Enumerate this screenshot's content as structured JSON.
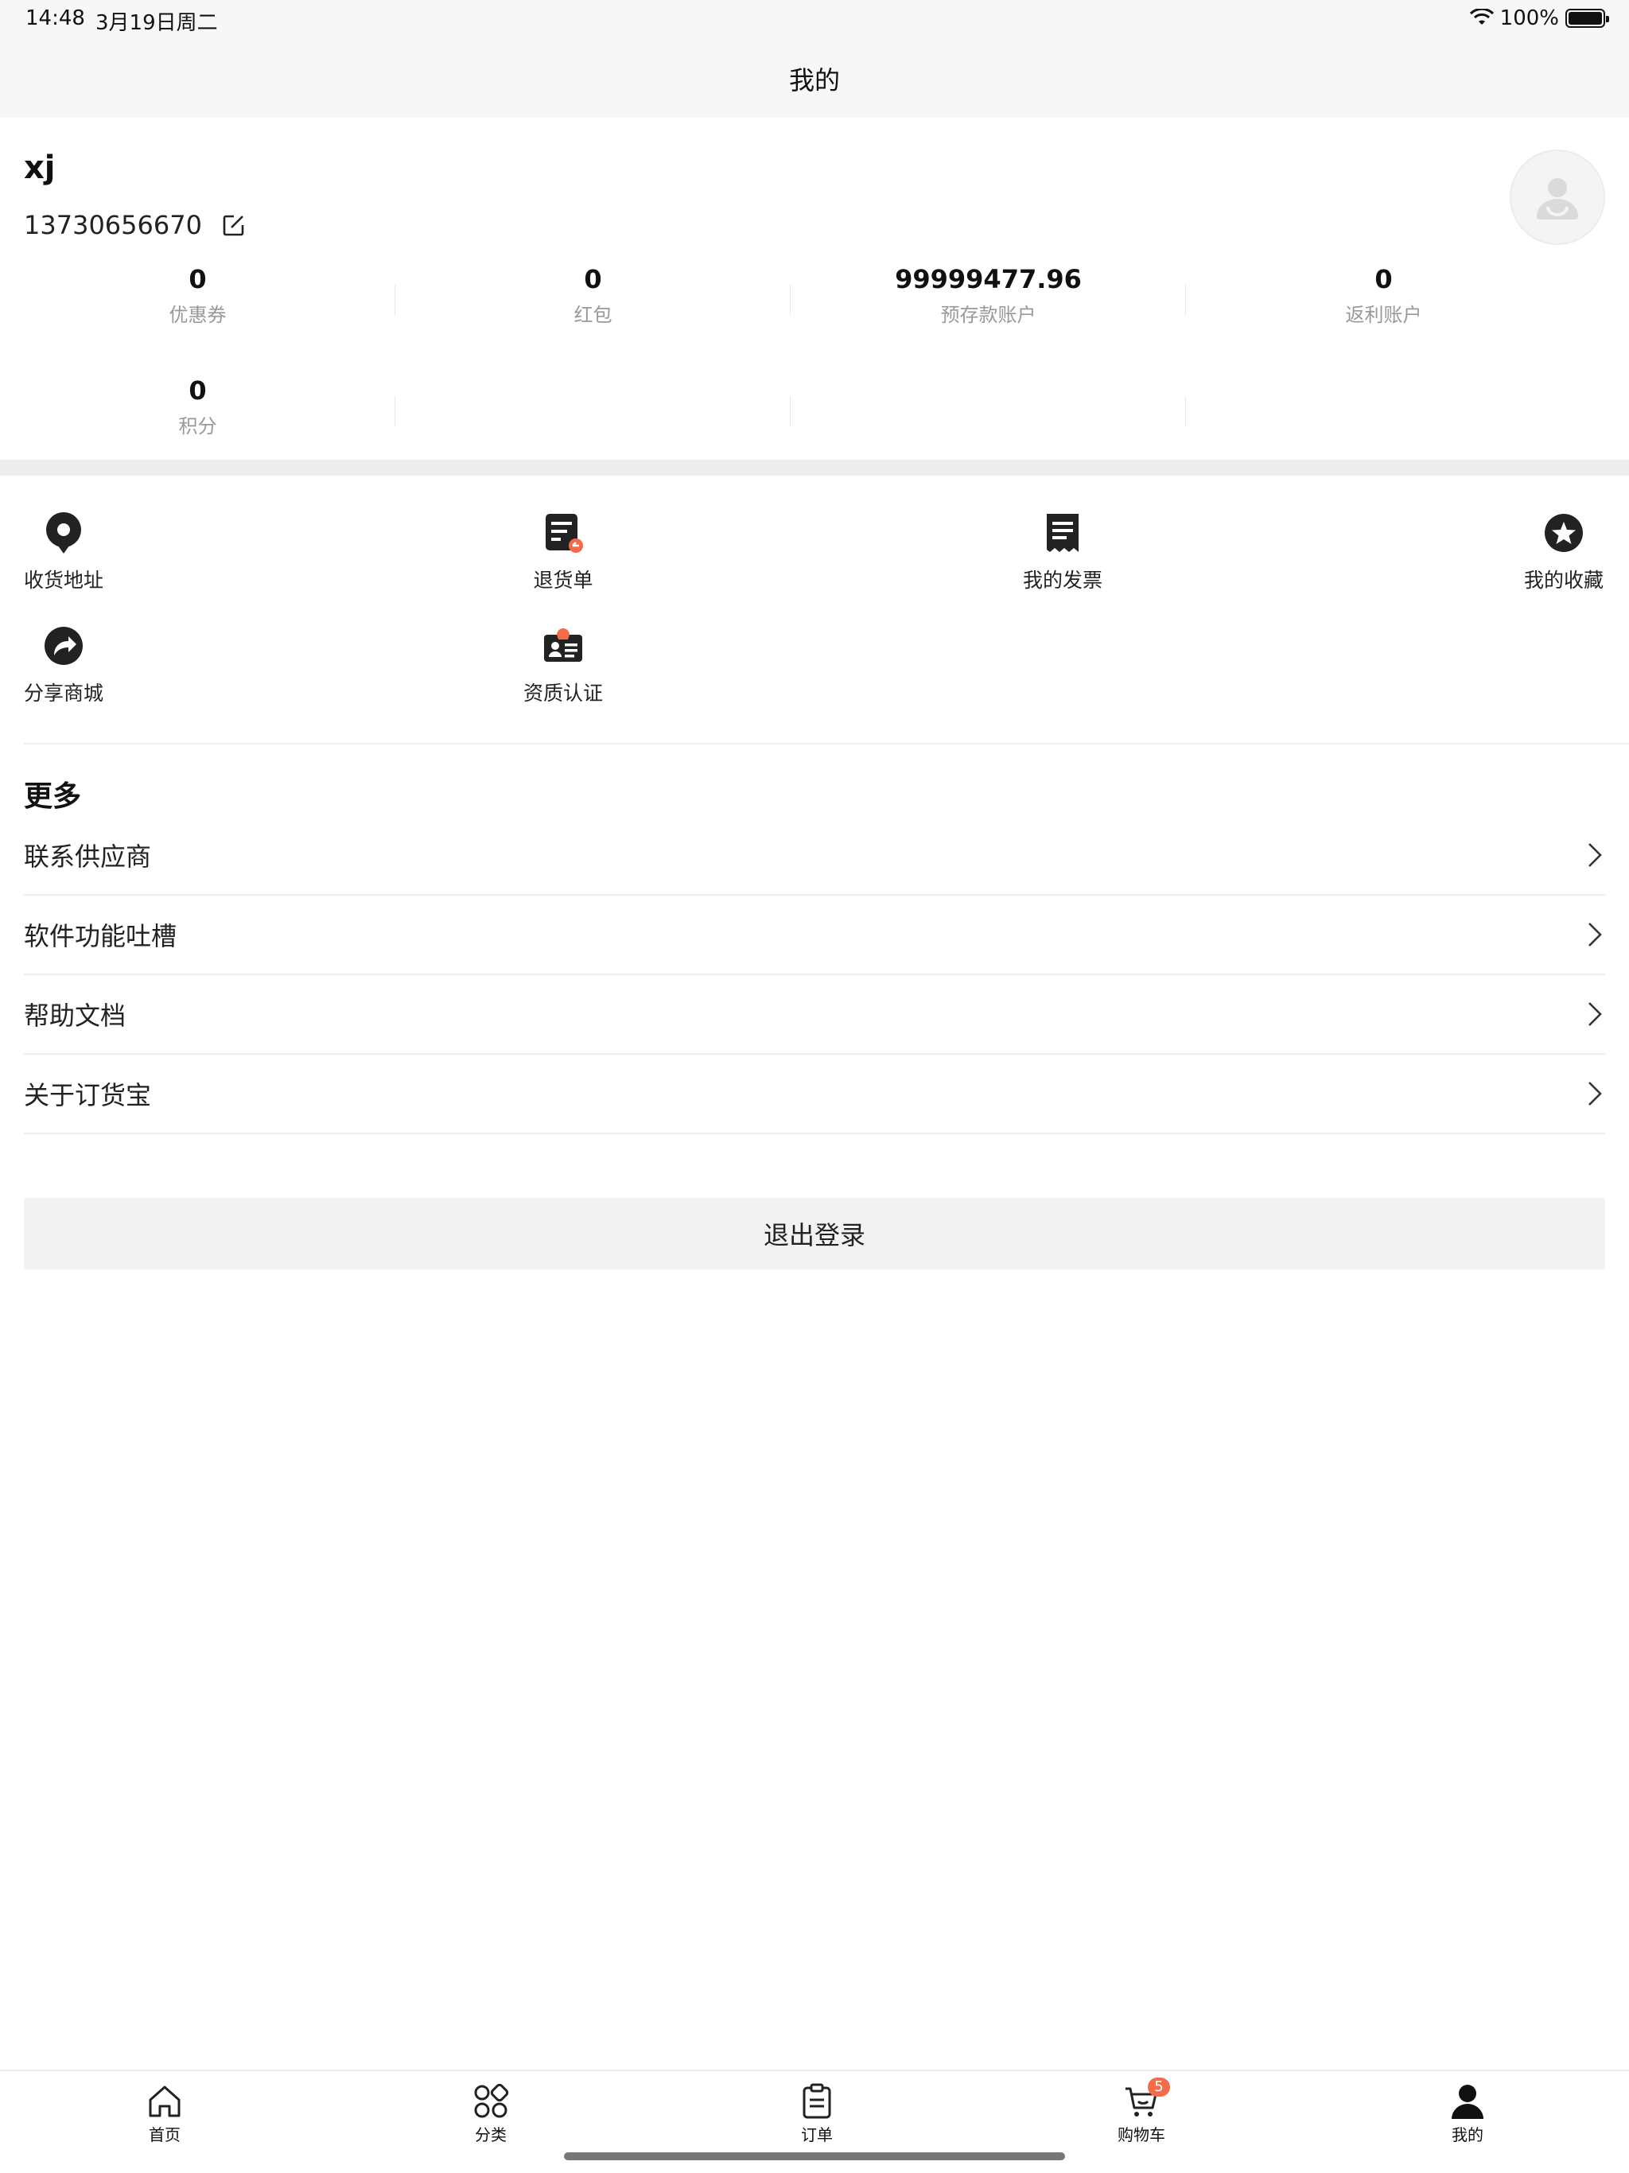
{
  "status_bar": {
    "time": "14:48",
    "date": "3月19日周二",
    "battery": "100%"
  },
  "header": {
    "title": "我的"
  },
  "profile": {
    "name": "xj",
    "phone": "13730656670",
    "stats": [
      {
        "value": "0",
        "label": "优惠券"
      },
      {
        "value": "0",
        "label": "红包"
      },
      {
        "value": "99999477.96",
        "label": "预存款账户"
      },
      {
        "value": "0",
        "label": "返利账户"
      },
      {
        "value": "0",
        "label": "积分"
      }
    ]
  },
  "quick_actions": [
    {
      "label": "收货地址",
      "icon": "location-pin-icon"
    },
    {
      "label": "退货单",
      "icon": "return-order-icon"
    },
    {
      "label": "我的发票",
      "icon": "invoice-icon"
    },
    {
      "label": "我的收藏",
      "icon": "star-icon"
    },
    {
      "label": "分享商城",
      "icon": "share-icon"
    },
    {
      "label": "资质认证",
      "icon": "certification-icon"
    }
  ],
  "more": {
    "title": "更多",
    "items": [
      {
        "label": "联系供应商"
      },
      {
        "label": "软件功能吐槽"
      },
      {
        "label": "帮助文档"
      },
      {
        "label": "关于订货宝"
      }
    ]
  },
  "logout_label": "退出登录",
  "tabbar": {
    "tabs": [
      {
        "label": "首页",
        "icon": "home-icon"
      },
      {
        "label": "分类",
        "icon": "category-icon"
      },
      {
        "label": "订单",
        "icon": "order-icon"
      },
      {
        "label": "购物车",
        "icon": "cart-icon",
        "badge": "5"
      },
      {
        "label": "我的",
        "icon": "user-icon"
      }
    ]
  },
  "colors": {
    "accent": "#f26b4a",
    "muted": "#999999",
    "band": "#ededed"
  }
}
